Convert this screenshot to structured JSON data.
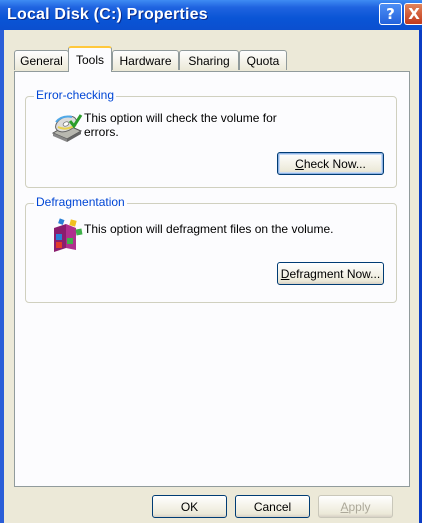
{
  "window": {
    "title": "Local Disk (C:) Properties",
    "help_label": "?",
    "close_label": "X"
  },
  "tabs": [
    {
      "label": "General"
    },
    {
      "label": "Tools",
      "active": true
    },
    {
      "label": "Hardware"
    },
    {
      "label": "Sharing"
    },
    {
      "label": "Quota"
    }
  ],
  "error_checking": {
    "title": "Error-checking",
    "description": "This option will check the volume for errors.",
    "button_mnemonic": "C",
    "button_rest": "heck Now..."
  },
  "defragmentation": {
    "title": "Defragmentation",
    "description": "This option will defragment files on the volume.",
    "button_mnemonic": "D",
    "button_rest": "efragment Now..."
  },
  "footer": {
    "ok_label": "OK",
    "cancel_label": "Cancel",
    "apply_mnemonic": "A",
    "apply_rest": "pply"
  },
  "colors": {
    "title_bar": "#0b4fcf",
    "group_title": "#0046d5",
    "active_tab_highlight": "#ffc83c"
  }
}
